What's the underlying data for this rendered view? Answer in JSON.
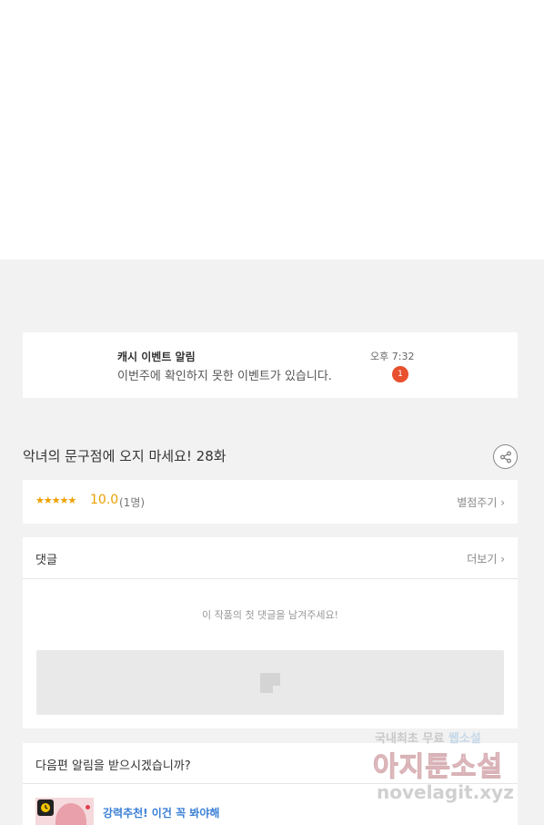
{
  "notification": {
    "title": "캐시 이벤트 알림",
    "body": "이번주에 확인하지 못한 이벤트가 있습니다.",
    "time": "오후 7:32",
    "badge_count": "1"
  },
  "episode": {
    "title": "악녀의 문구점에 오지 마세요! 28화",
    "share_icon": "share-icon"
  },
  "rating": {
    "stars": "★★★★★",
    "score": "10.0",
    "count": "(1명)",
    "rate_link": "별점주기 ›",
    "accent": "#f0a000"
  },
  "comments": {
    "title": "댓글",
    "more_link": "더보기 ›",
    "empty_message": "이 작품의 첫 댓글을 남겨주세요!"
  },
  "next_episode": {
    "title": "다음편 알림을 받으시겠습니까?",
    "recommend_text": "강력추천! 이건 꼭 봐야해",
    "recommend_color": "#3a7fd5"
  },
  "watermark": {
    "line1_a": "국내최초 무료",
    "line1_b": "웹소설",
    "line2": "아지툰소설",
    "line3": "novelagit.xyz"
  }
}
